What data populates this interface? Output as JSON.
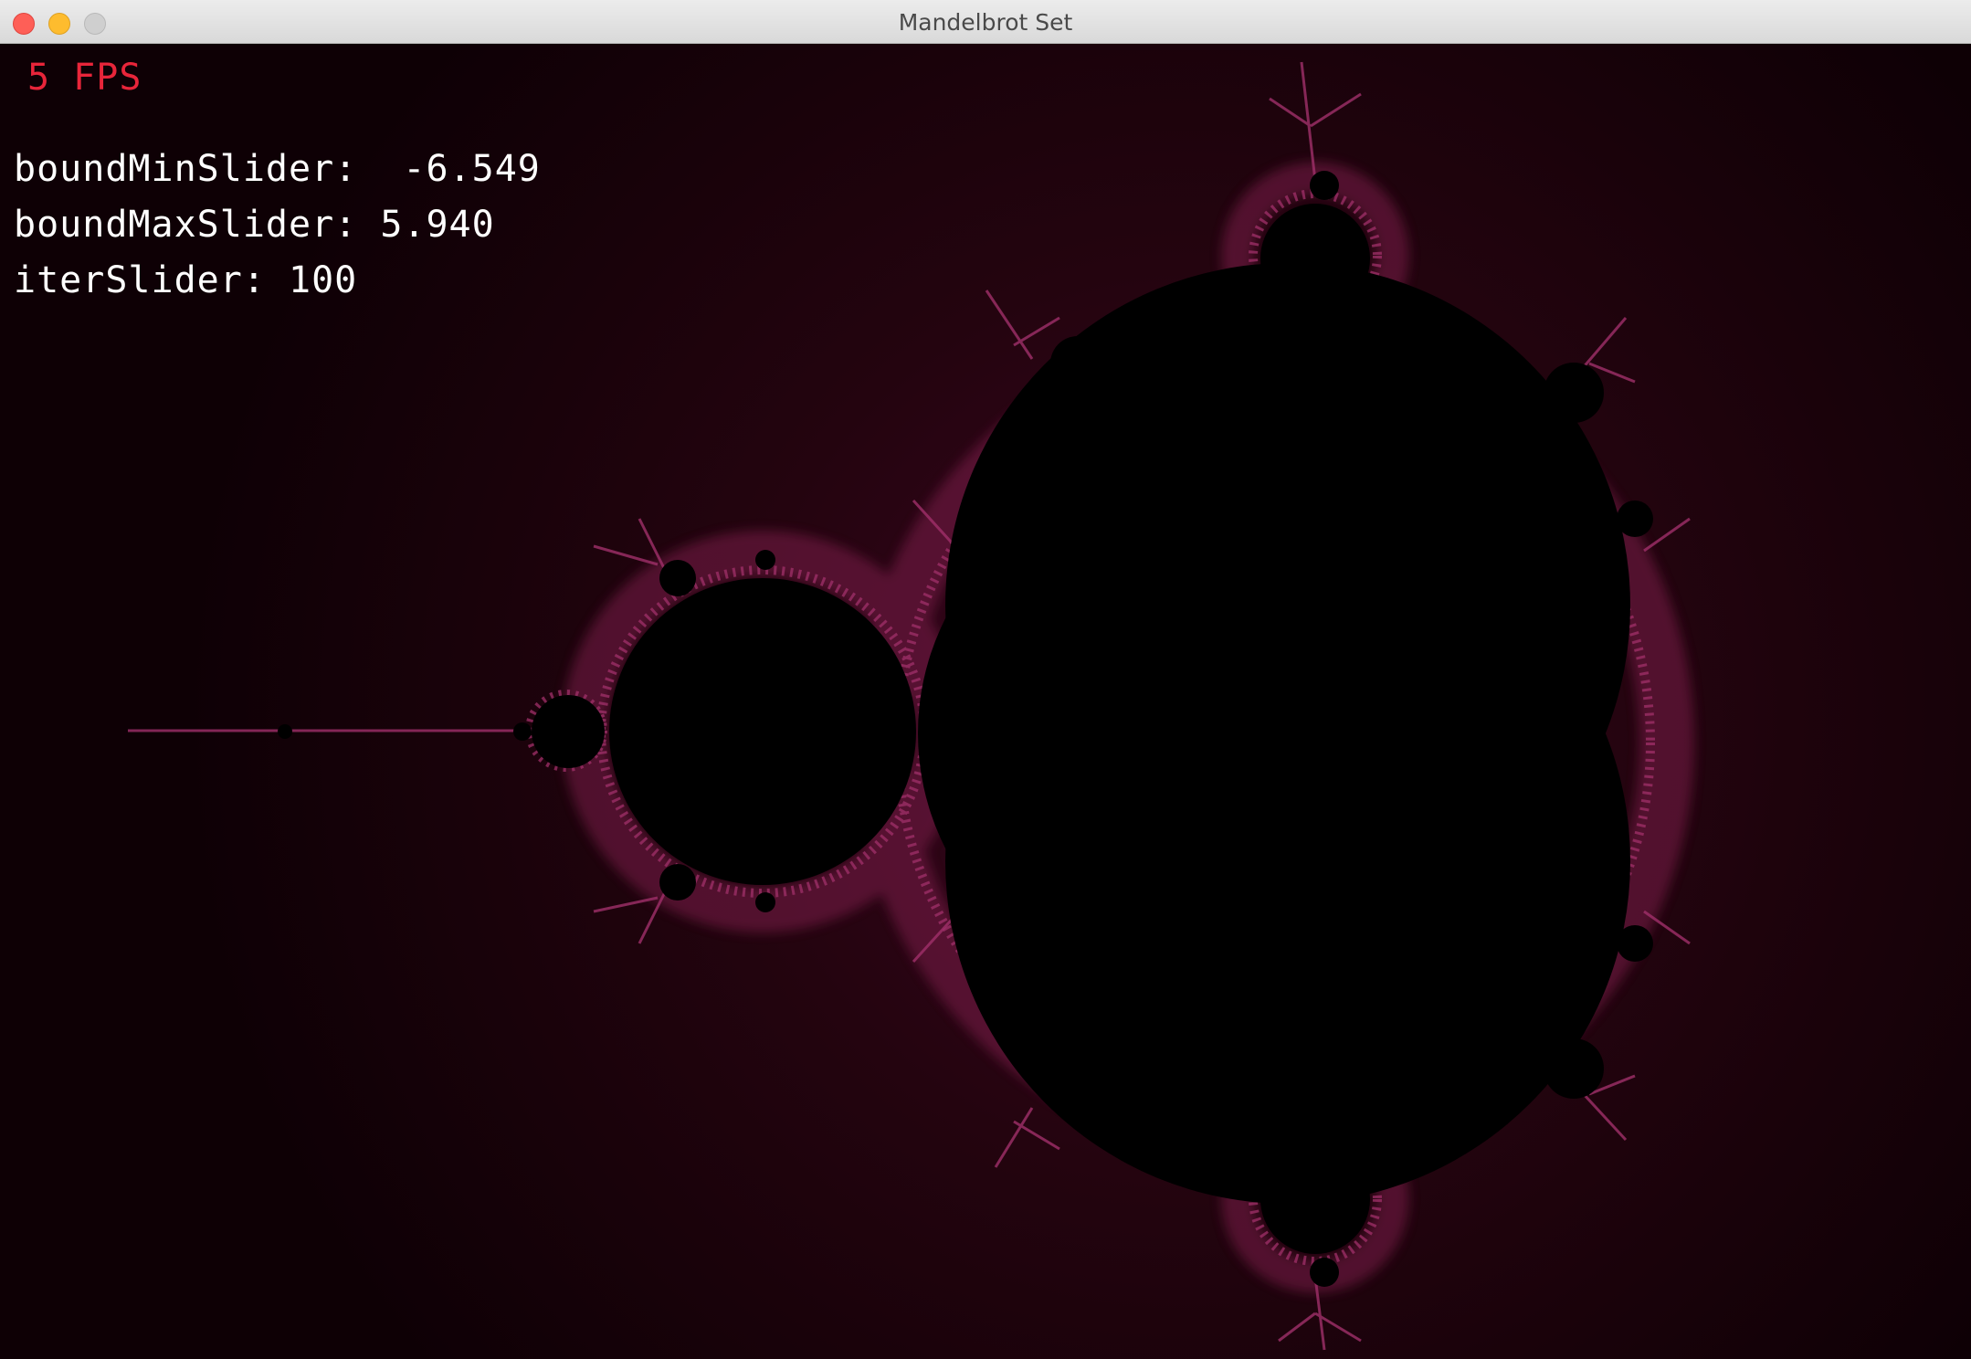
{
  "window": {
    "title": "Mandelbrot Set"
  },
  "hud": {
    "fps_label": "5 FPS",
    "bound_min_label": "boundMinSlider:  -6.549",
    "bound_max_label": "boundMaxSlider: 5.940",
    "iter_label": "iterSlider: 100"
  },
  "colors": {
    "background": "#140008",
    "set_interior": "#000000",
    "fractal_edge": "#a0306a",
    "fps_text": "#e8253a",
    "hud_text": "#ffffff"
  },
  "icons": {
    "close": "close-circle",
    "minimize": "minimize-circle",
    "zoom": "zoom-circle"
  }
}
